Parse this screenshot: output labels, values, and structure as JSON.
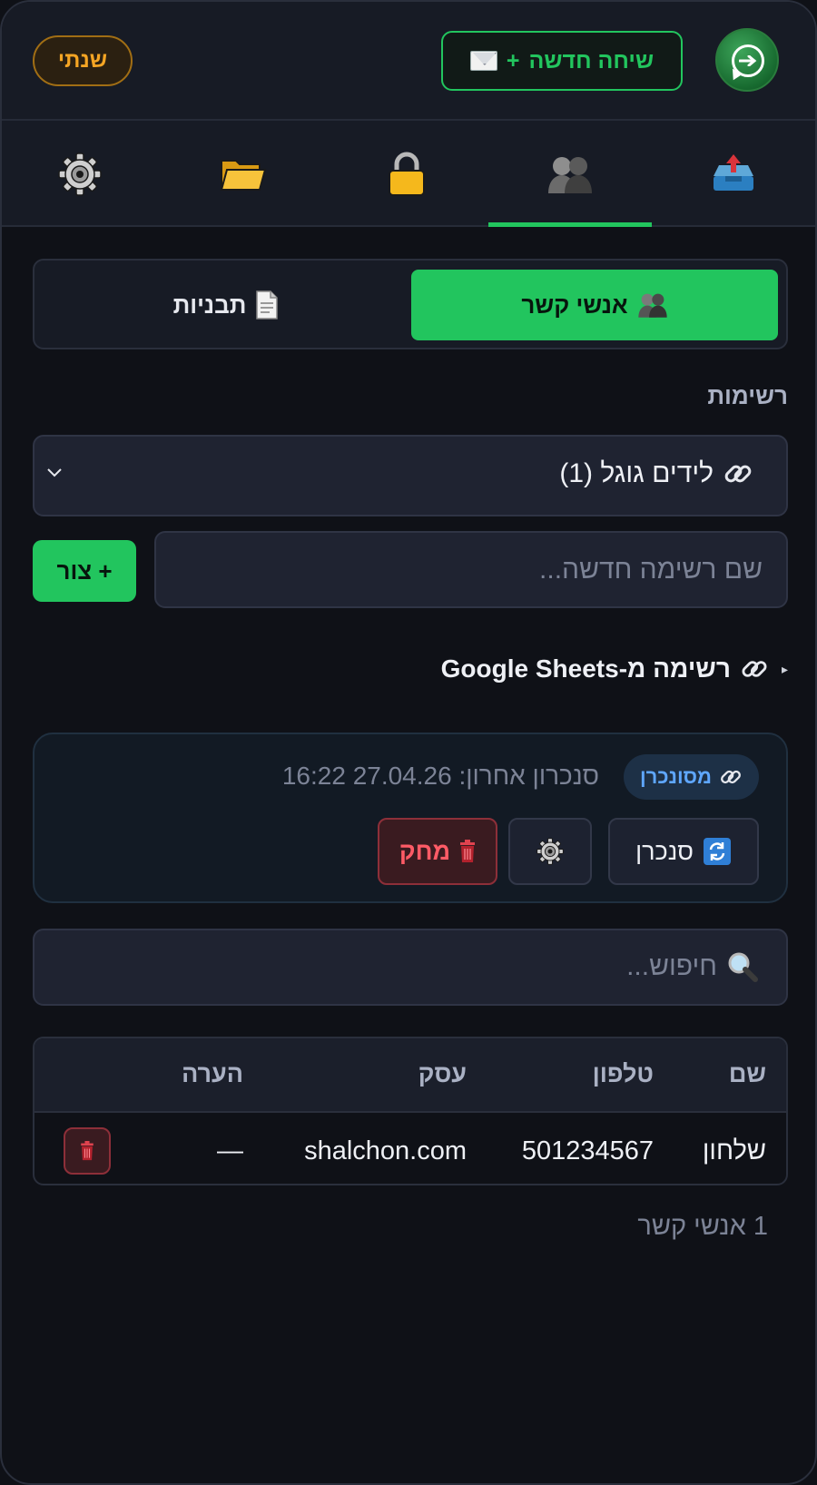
{
  "header": {
    "new_chat_label": "שיחה חדשה",
    "new_chat_plus": "+",
    "user_name": "שנתי"
  },
  "nav": {
    "tabs": [
      "upload-icon",
      "contacts-icon",
      "lock-icon",
      "folder-icon",
      "gear-icon"
    ],
    "active_index": 1
  },
  "segment": {
    "contacts_label": "אנשי קשר",
    "templates_label": "תבניות",
    "active": "contacts"
  },
  "lists": {
    "title": "רשימות",
    "selected": "לידים גוגל (1)",
    "new_placeholder": "שם רשימה חדשה...",
    "create_label": "+ צור",
    "sheets_label": "רשימה מ-Google Sheets"
  },
  "sync": {
    "status": "מסונכרן",
    "last_sync": "סנכרון אחרון: 27.04.26 16:22",
    "sync_label": "סנכרן",
    "delete_label": "מחק"
  },
  "search": {
    "placeholder": "חיפוש..."
  },
  "table": {
    "headers": {
      "name": "שם",
      "phone": "טלפון",
      "business": "עסק",
      "note": "הערה"
    },
    "rows": [
      {
        "name": "שלחון",
        "phone": "501234567",
        "business": "shalchon.com",
        "note": "—"
      }
    ]
  },
  "footer": {
    "count": "1 אנשי קשר"
  },
  "colors": {
    "accent": "#22c55e",
    "user_badge": "#f5a524",
    "danger": "#ff5b66",
    "info": "#5fa7ff",
    "background": "#0f1117"
  }
}
